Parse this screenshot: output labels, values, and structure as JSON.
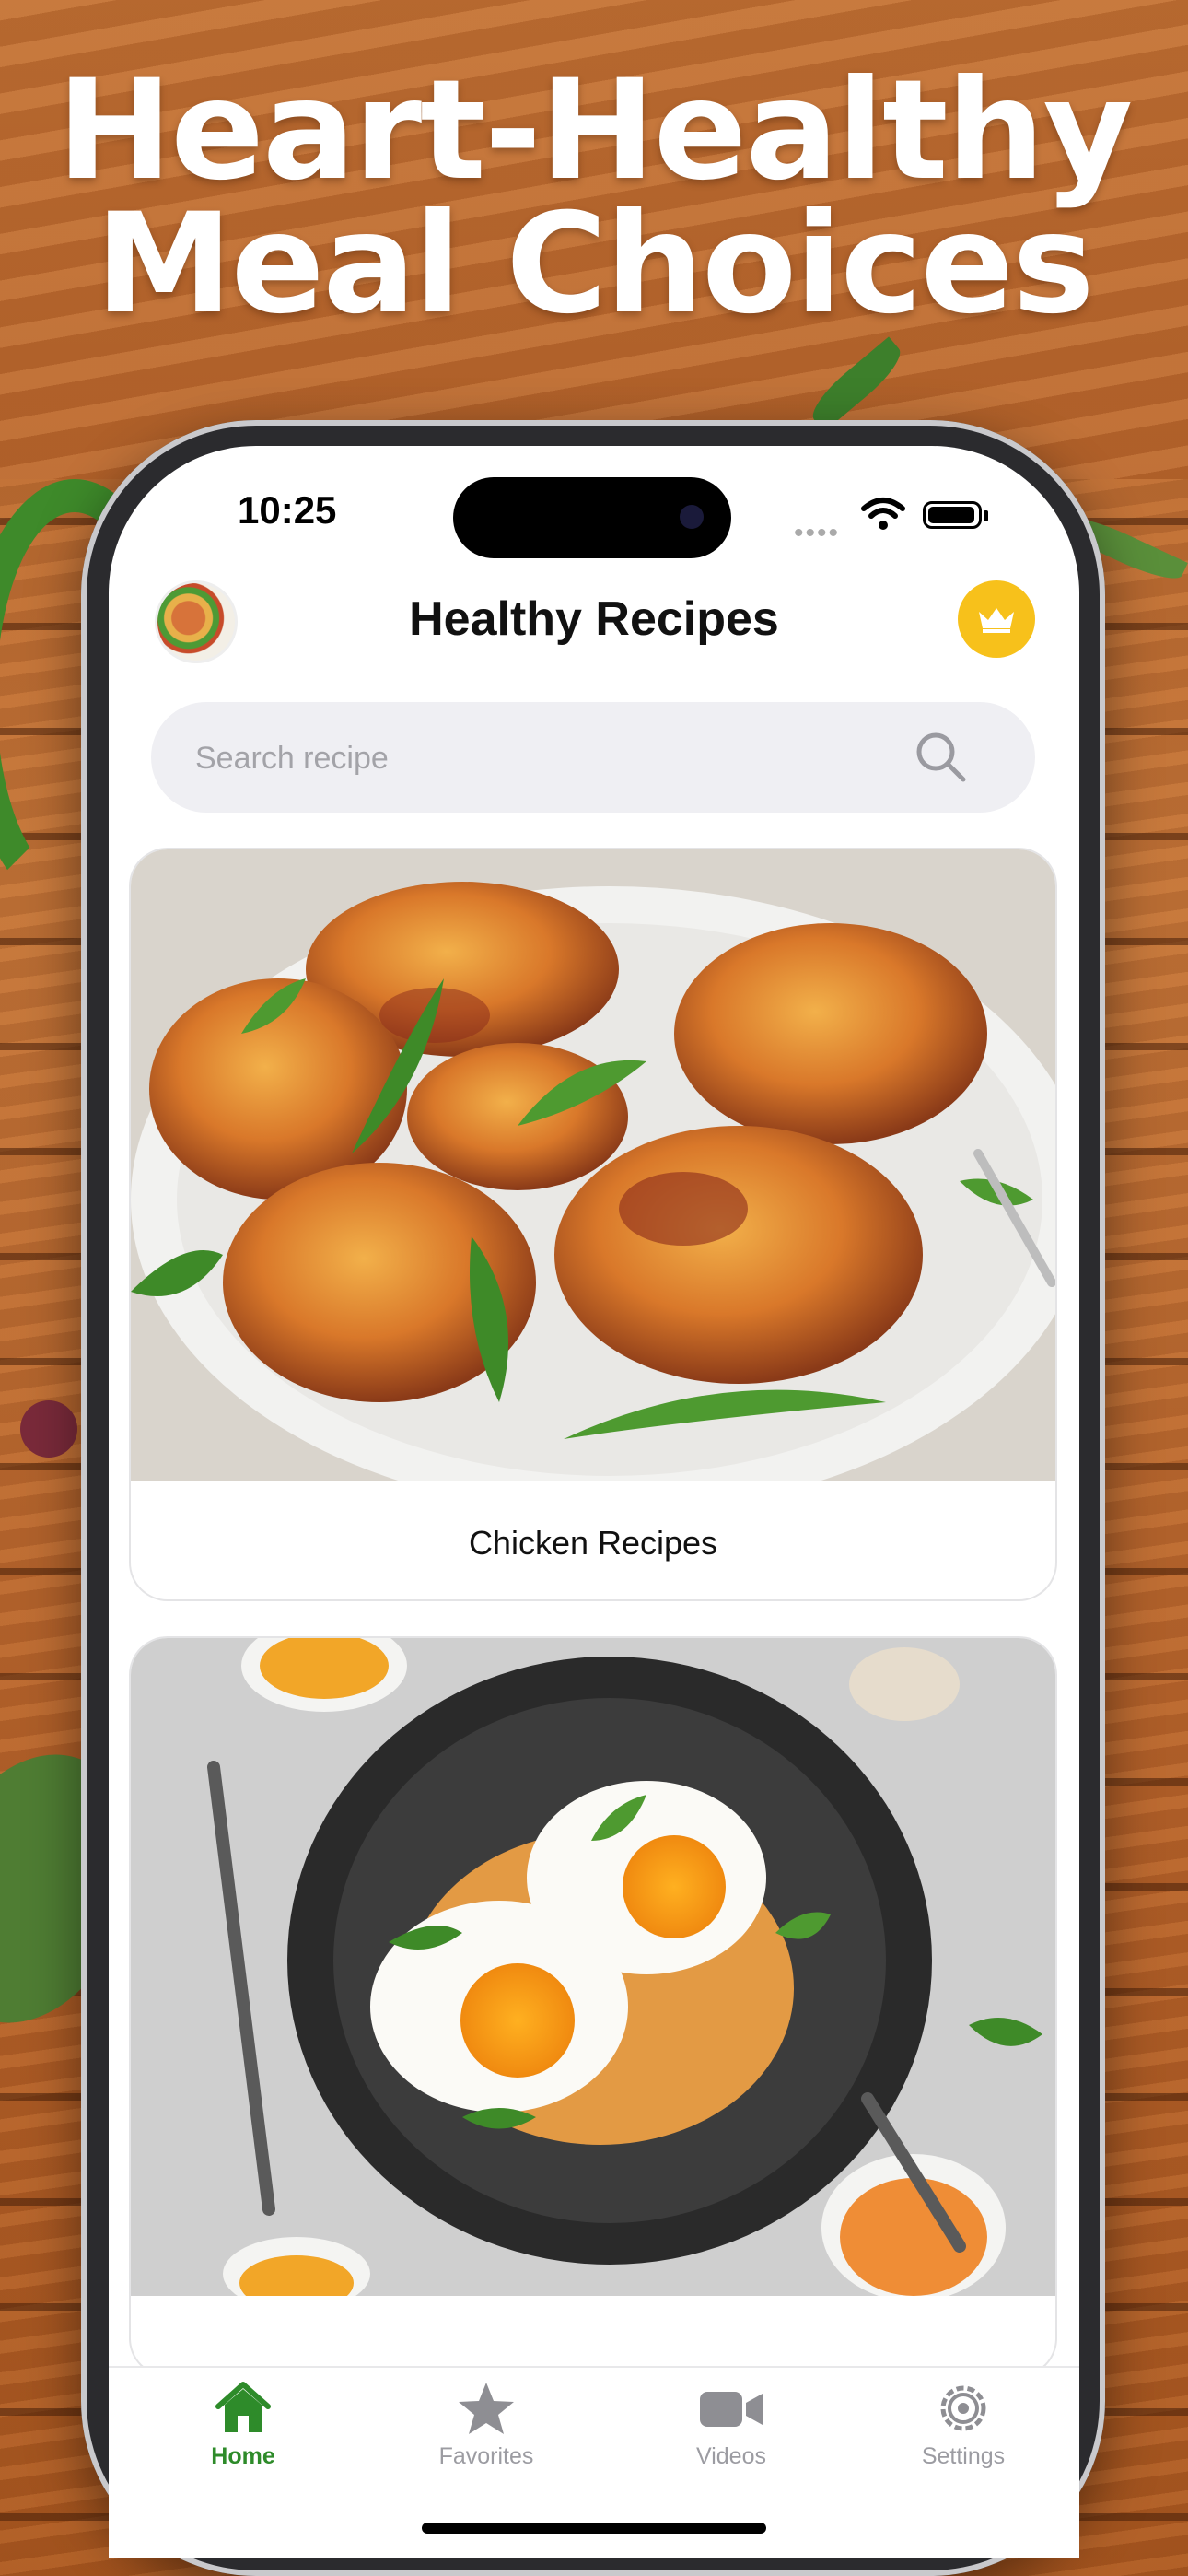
{
  "promo": {
    "headline_line1": "Heart-Healthy",
    "headline_line2": "Meal Choices"
  },
  "status_bar": {
    "time": "10:25"
  },
  "header": {
    "title": "Healthy Recipes"
  },
  "search": {
    "placeholder": "Search recipe"
  },
  "recipes": [
    {
      "label": "Chicken Recipes"
    },
    {
      "label": ""
    }
  ],
  "tabs": [
    {
      "label": "Home",
      "icon": "house-icon",
      "active": true
    },
    {
      "label": "Favorites",
      "icon": "star-icon",
      "active": false
    },
    {
      "label": "Videos",
      "icon": "video-camera-icon",
      "active": false
    },
    {
      "label": "Settings",
      "icon": "gear-icon",
      "active": false
    }
  ],
  "colors": {
    "accent": "#2e8b2a",
    "premium": "#f7c11b",
    "inactive_tab": "#9c9ca2"
  }
}
